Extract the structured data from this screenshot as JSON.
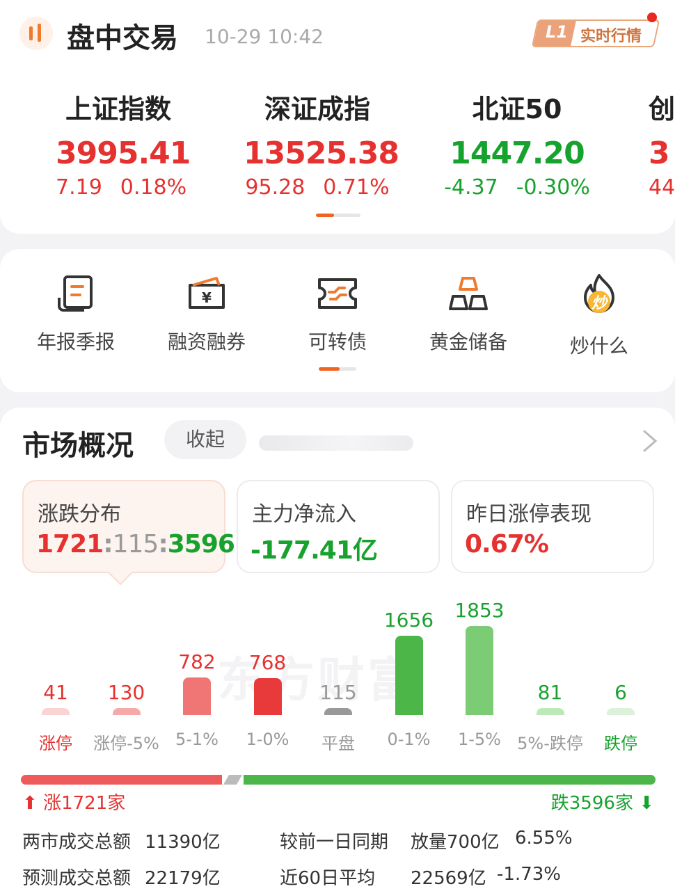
{
  "header": {
    "title": "盘中交易",
    "time": "10-29 10:42",
    "badge_level": "L1",
    "badge_text": "实时行情"
  },
  "indices": [
    {
      "name": "上证指数",
      "value": "3995.41",
      "change": "7.19",
      "pct": "0.18%",
      "trend": "up"
    },
    {
      "name": "深证成指",
      "value": "13525.38",
      "change": "95.28",
      "pct": "0.71%",
      "trend": "up"
    },
    {
      "name": "北证50",
      "value": "1447.20",
      "change": "-4.37",
      "pct": "-0.30%",
      "trend": "down"
    },
    {
      "name": "创",
      "value": "3",
      "change": "44",
      "pct": "",
      "trend": "up"
    }
  ],
  "shortcuts": [
    {
      "label": "年报季报",
      "icon": "report-icon"
    },
    {
      "label": "融资融券",
      "icon": "wallet-yen-icon"
    },
    {
      "label": "可转债",
      "icon": "ticket-icon"
    },
    {
      "label": "黄金储备",
      "icon": "gold-bars-icon"
    },
    {
      "label": "炒什么",
      "icon": "fire-icon",
      "icon_text": "炒"
    }
  ],
  "market": {
    "title": "市场概况",
    "collapse_label": "收起",
    "tiles": [
      {
        "label": "涨跌分布",
        "up": "1721",
        "sep1": ":",
        "flat": "115",
        "sep2": ":",
        "down": "3596"
      },
      {
        "label": "主力净流入",
        "value": "-177.41亿"
      },
      {
        "label": "昨日涨停表现",
        "value": "0.67%"
      }
    ],
    "watermark": "东方财富"
  },
  "chart_data": {
    "type": "bar",
    "categories": [
      "涨停",
      "涨停-5%",
      "5-1%",
      "1-0%",
      "平盘",
      "0-1%",
      "1-5%",
      "5%-跌停",
      "跌停"
    ],
    "values": [
      41,
      130,
      782,
      768,
      115,
      1656,
      1853,
      81,
      6
    ],
    "colors": [
      "#f9d4d3",
      "#f5aaa9",
      "#f07575",
      "#e8393b",
      "#999999",
      "#4cb648",
      "#7bcc74",
      "#bde8b8",
      "#dcf1d9"
    ]
  },
  "summary": {
    "up_label": "涨1721家",
    "down_label": "跌3596家",
    "up_count": 1721,
    "flat_count": 115,
    "down_count": 3596,
    "rows": [
      {
        "label": "两市成交总额",
        "value": "11390亿",
        "label2": "较前一日同期",
        "value2": "放量700亿",
        "value3": "6.55%"
      },
      {
        "label": "预测成交总额",
        "value": "22179亿",
        "label2": "近60日平均",
        "value2": "22569亿",
        "value3": "-1.73%"
      }
    ]
  }
}
